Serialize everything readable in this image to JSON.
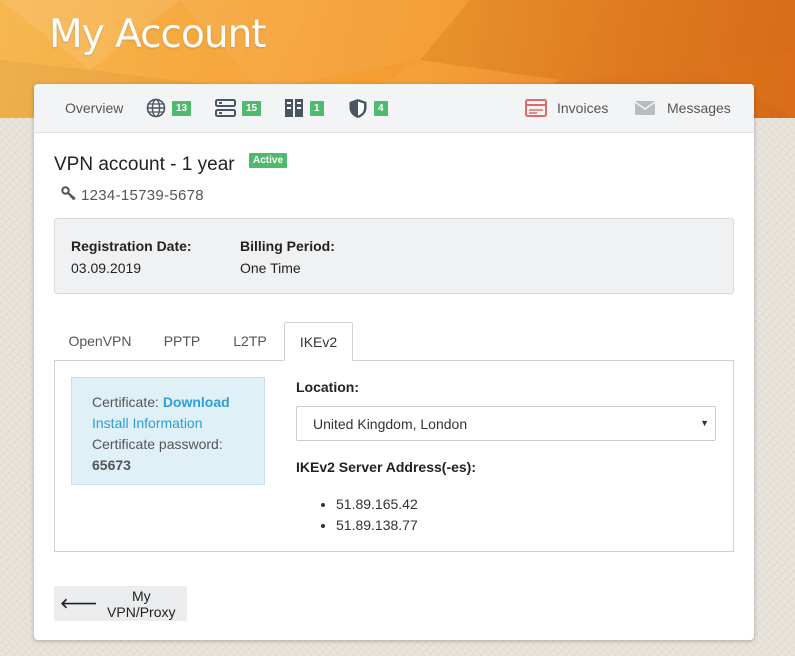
{
  "page_title": "My Account",
  "nav": {
    "overview": "Overview",
    "badges": {
      "globe": "13",
      "servers": "15",
      "files": "1",
      "shield": "4"
    },
    "invoices": "Invoices",
    "messages": "Messages"
  },
  "account": {
    "title": "VPN account - 1 year",
    "status": "Active",
    "id": "1234-15739-5678"
  },
  "info": {
    "registration_label": "Registration Date:",
    "registration_value": "03.09.2019",
    "billing_label": "Billing Period:",
    "billing_value": "One Time"
  },
  "tabs": [
    "OpenVPN",
    "PPTP",
    "L2TP",
    "IKEv2"
  ],
  "active_tab": "IKEv2",
  "certificate": {
    "label": "Certificate:",
    "download": "Download",
    "install": "Install Information",
    "password_label": "Certificate password:",
    "password": "65673"
  },
  "location": {
    "label": "Location:",
    "selected": "United Kingdom, London"
  },
  "server": {
    "label": "IKEv2 Server Address(-es):",
    "addresses": [
      "51.89.165.42",
      "51.89.138.77"
    ]
  },
  "back_button": "My VPN/Proxy",
  "colors": {
    "accent_green": "#4fb96d",
    "link_blue": "#2b9fd6",
    "hero_orange": "#f39a2f",
    "invoice_red": "#e06a6a"
  },
  "icons": {
    "globe": "globe-icon",
    "servers": "servers-icon",
    "files": "files-icon",
    "shield": "shield-icon",
    "invoices": "invoice-icon",
    "messages": "envelope-icon",
    "key": "key-icon",
    "back": "arrow-left-icon"
  }
}
